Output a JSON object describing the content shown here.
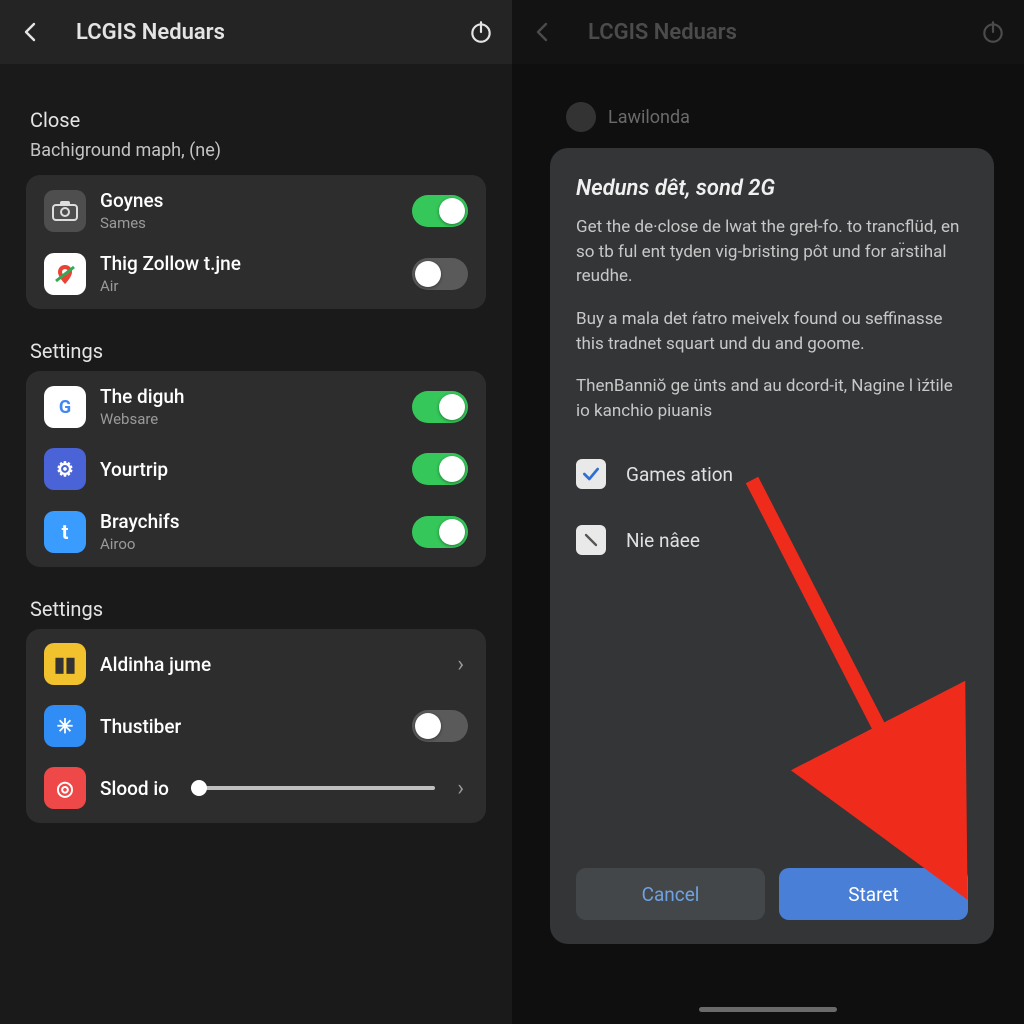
{
  "left": {
    "header": {
      "title": "LCGIS Neduars"
    },
    "section1": {
      "label": "Close",
      "sub": "Bachiground maph, (ne)",
      "rows": [
        {
          "title": "Goynes",
          "sub": "Sames",
          "toggle": true
        },
        {
          "title": "Thig Zollow t.jne",
          "sub": "Air",
          "toggle": false
        }
      ]
    },
    "section2": {
      "label": "Settings",
      "rows": [
        {
          "title": "The diguh",
          "sub": "Websare",
          "toggle": true
        },
        {
          "title": "Yourtrip",
          "sub": "",
          "toggle": true
        },
        {
          "title": "Braychifs",
          "sub": "Airoo",
          "toggle": true
        }
      ]
    },
    "section3": {
      "label": "Settings",
      "rows": [
        {
          "title": "Aldinha jume",
          "type": "chev"
        },
        {
          "title": "Thustiber",
          "type": "toggle",
          "toggle": false
        },
        {
          "title": "Slood io",
          "type": "slider"
        }
      ]
    }
  },
  "right": {
    "header": {
      "title": "LCGIS Neduars"
    },
    "dimmed_row": "Lawilonda",
    "dialog": {
      "title": "Neduns dêt, sond 2G",
      "p1": "Get the de·close de lwat the greł-fo. to trancflüd, en so tb ful ent tyden vig-bristing pôt und for ar̈stihal reudhe.",
      "p2": "Buy a mala det ŕatro meivelx found ou seffinasse this tradnet squart und du and goome.",
      "p3": "ThenBanniŏ ge ünts and au dcord-it, Nagine l ìźtile io kanchio piuanis",
      "check1": "Games ation",
      "check2": "Nie nâee",
      "cancel": "Cancel",
      "start": "Staret",
      "check1_state": true,
      "check2_state": false
    }
  }
}
